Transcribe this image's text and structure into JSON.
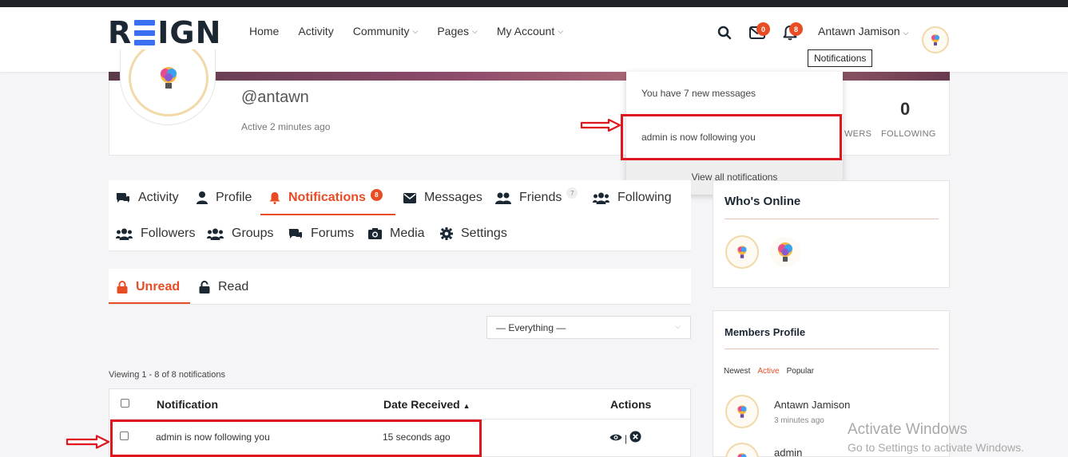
{
  "header": {
    "logo": "REIGN",
    "logo_parts": {
      "r": "R",
      "rest": "IGN"
    },
    "nav": [
      {
        "label": "Home"
      },
      {
        "label": "Activity"
      },
      {
        "label": "Community"
      },
      {
        "label": "Pages"
      },
      {
        "label": "My Account"
      }
    ],
    "messages_badge": "0",
    "notifications_badge": "8",
    "user_name": "Antawn Jamison",
    "tooltip": "Notifications"
  },
  "profile": {
    "handle": "@antawn",
    "active": "Active 2 minutes ago",
    "following_count": "0",
    "following_label": "FOLLOWING",
    "followers_label_partial": "WERS"
  },
  "notif_dropdown": {
    "messages_line": "You have 7 new messages",
    "follow_line": "admin is now following you",
    "view_all": "View all notifications"
  },
  "tabs": [
    {
      "label": "Activity"
    },
    {
      "label": "Profile"
    },
    {
      "label": "Notifications",
      "count": "8"
    },
    {
      "label": "Messages"
    },
    {
      "label": "Friends",
      "count": "7"
    },
    {
      "label": "Following"
    },
    {
      "label": "Followers"
    },
    {
      "label": "Groups"
    },
    {
      "label": "Forums"
    },
    {
      "label": "Media"
    },
    {
      "label": "Settings"
    }
  ],
  "subtabs": {
    "unread": "Unread",
    "read": "Read"
  },
  "filter": {
    "selected": "— Everything —"
  },
  "viewing": "Viewing 1 - 8 of 8 notifications",
  "table": {
    "headers": {
      "notification": "Notification",
      "date": "Date Received",
      "actions": "Actions"
    },
    "sort_indicator": "▲",
    "rows": [
      {
        "notification": "admin is now following you",
        "date": "15 seconds ago",
        "separator": "|"
      }
    ]
  },
  "sidebar": {
    "whos_online": {
      "title": "Who's Online"
    },
    "members": {
      "title": "Members Profile",
      "filters": [
        "Newest",
        "Active",
        "Popular"
      ],
      "active_filter": "Active",
      "list": [
        {
          "name": "Antawn Jamison",
          "time": "3 minutes ago"
        },
        {
          "name": "admin"
        }
      ]
    }
  },
  "watermark": {
    "line1": "Activate Windows",
    "line2": "Go to Settings to activate Windows."
  },
  "colors": {
    "accent": "#e74c24",
    "highlight": "#e0161e",
    "logo_blue": "#3a6ff2",
    "dark": "#1b2733"
  }
}
